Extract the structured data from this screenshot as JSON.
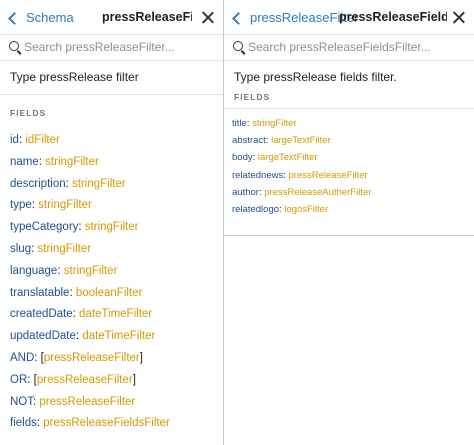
{
  "left_panel": {
    "back_label": "Schema",
    "title": "pressReleaseFilter",
    "search_placeholder": "Search pressReleaseFilter...",
    "description": "Type pressRelease filter",
    "section_label": "FIELDS",
    "fields": [
      {
        "name": "id",
        "type": "idFilter",
        "list": false
      },
      {
        "name": "name",
        "type": "stringFilter",
        "list": false
      },
      {
        "name": "description",
        "type": "stringFilter",
        "list": false
      },
      {
        "name": "type",
        "type": "stringFilter",
        "list": false
      },
      {
        "name": "typeCategory",
        "type": "stringFilter",
        "list": false
      },
      {
        "name": "slug",
        "type": "stringFilter",
        "list": false
      },
      {
        "name": "language",
        "type": "stringFilter",
        "list": false
      },
      {
        "name": "translatable",
        "type": "booleanFilter",
        "list": false
      },
      {
        "name": "createdDate",
        "type": "dateTimeFilter",
        "list": false
      },
      {
        "name": "updatedDate",
        "type": "dateTimeFilter",
        "list": false
      },
      {
        "name": "AND",
        "type": "pressReleaseFilter",
        "list": true
      },
      {
        "name": "OR",
        "type": "pressReleaseFilter",
        "list": true
      },
      {
        "name": "NOT",
        "type": "pressReleaseFilter",
        "list": false
      },
      {
        "name": "fields",
        "type": "pressReleaseFieldsFilter",
        "list": false
      }
    ]
  },
  "right_panel": {
    "back_label": "pressReleaseFilter",
    "title": "pressReleaseFieldsFi...",
    "search_placeholder": "Search pressReleaseFieldsFilter...",
    "description": "Type pressRelease fields filter.",
    "section_label": "FIELDS",
    "fields": [
      {
        "name": "title",
        "type": "stringFilter",
        "list": false
      },
      {
        "name": "abstract",
        "type": "largeTextFilter",
        "list": false
      },
      {
        "name": "body",
        "type": "largeTextFilter",
        "list": false
      },
      {
        "name": "relatednews",
        "type": "pressReleaseFilter",
        "list": false
      },
      {
        "name": "author",
        "type": "pressReleaseAutherFilter",
        "list": false
      },
      {
        "name": "relatedlogo",
        "type": "logosFilter",
        "list": false
      }
    ]
  },
  "colors": {
    "link_blue": "#2b7bbd",
    "field_name": "#1f4f8f",
    "type_gold": "#d39a00",
    "divider": "#c8c8c8"
  },
  "icons": [
    "chevron-left-icon",
    "close-icon",
    "search-icon"
  ]
}
